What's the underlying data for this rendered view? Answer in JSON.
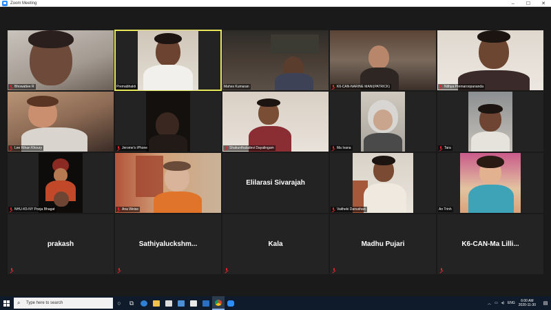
{
  "window": {
    "title": "Zoom Meeting",
    "minimize": "–",
    "maximize": "☐",
    "close": "✕"
  },
  "participants": [
    {
      "label": "Bhowattee R",
      "has_video": true
    },
    {
      "label": "Premabhakti",
      "has_video": true,
      "active_speaker": true
    },
    {
      "label": "Mahes Kumaran",
      "has_video": true
    },
    {
      "label": "K6-CAN-NARINE MANI(PATRICK)",
      "has_video": true
    },
    {
      "label": "Nithya Premaroopananda",
      "has_video": true
    },
    {
      "label": "Lee Rihan Khoury",
      "has_video": true
    },
    {
      "label": "Jerome's iPhone",
      "has_video": true
    },
    {
      "label": "Shakunthaladevi Dayalingam",
      "has_video": true
    },
    {
      "label": "Ma Ivana",
      "has_video": true
    },
    {
      "label": "Tara",
      "has_video": true
    },
    {
      "label": "NHU-K5-NY Pooja Bhagat",
      "has_video": true
    },
    {
      "label": "Ana Weise",
      "has_video": true
    },
    {
      "label": "Elilarasi Sivarajah",
      "has_video": false
    },
    {
      "label": "Vaitheki Danushan",
      "has_video": true
    },
    {
      "label": "An Trinh",
      "has_video": true
    },
    {
      "label": "prakash",
      "has_video": false
    },
    {
      "label": "Sathiyaluckshm...",
      "has_video": false
    },
    {
      "label": "Kala",
      "has_video": false
    },
    {
      "label": "Madhu Pujari",
      "has_video": false
    },
    {
      "label": "K6-CAN-Ma Lilli...",
      "has_video": false
    }
  ],
  "taskbar": {
    "search_placeholder": "Type here to search",
    "pinned_icons": [
      "task-view-icon",
      "edge-icon",
      "file-explorer-icon",
      "store-icon",
      "mail-icon",
      "windows-security-icon",
      "outlook-icon",
      "chrome-icon",
      "zoom-icon"
    ],
    "tray": {
      "language": "ENG",
      "time": "6:00 AM",
      "date": "2020-11-30"
    }
  },
  "colors": {
    "active_speaker_border": "#e9e95c",
    "muted_icon": "#e0242b",
    "taskbar_bg": "#0f1a2a"
  }
}
